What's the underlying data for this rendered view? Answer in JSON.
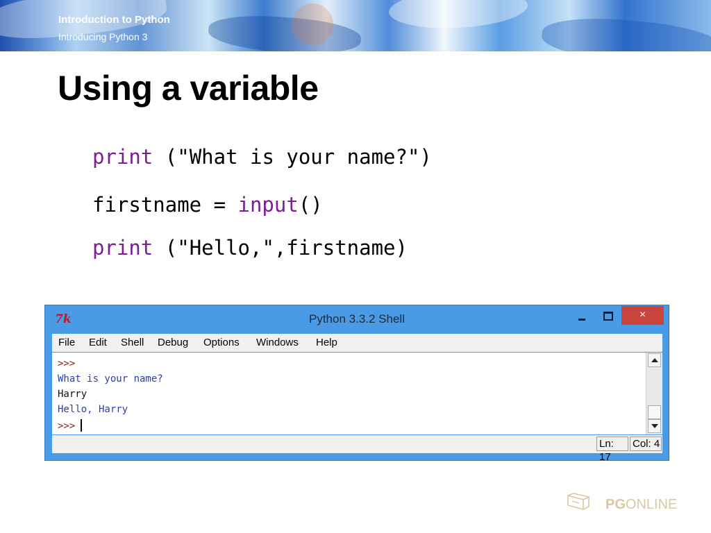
{
  "header": {
    "title": "Introduction to Python",
    "subtitle": "Introducing Python 3"
  },
  "slide": {
    "title": "Using a variable",
    "code_lines": [
      {
        "kw": "print",
        "rest": " (\"What is your name?\")"
      },
      {
        "plain": "firstname = ",
        "kw": "input",
        "rest": "()"
      },
      {
        "kw": "print",
        "rest": " (\"Hello,\",firstname)"
      }
    ]
  },
  "shell": {
    "title": "Python 3.3.2 Shell",
    "icon": "tk-feather-icon",
    "close_label": "×",
    "menu": [
      "File",
      "Edit",
      "Shell",
      "Debug",
      "Options",
      "Windows",
      "Help"
    ],
    "lines": [
      {
        "type": "prompt",
        "text": ">>>"
      },
      {
        "type": "out",
        "text": "What is your name?"
      },
      {
        "type": "inp",
        "text": "Harry"
      },
      {
        "type": "out",
        "text": "Hello, Harry"
      },
      {
        "type": "prompt",
        "text": ">>>"
      }
    ],
    "status": {
      "ln": "Ln: 17",
      "col": "Col: 4"
    }
  },
  "footer": {
    "logo_text_bold": "PG",
    "logo_text": "ONLINE"
  },
  "colors": {
    "keyword": "#7a1e96",
    "string": "#0a7a0a",
    "shell_output": "#2a3fb5",
    "titlebar": "#4a9be6",
    "close": "#c9443a"
  }
}
